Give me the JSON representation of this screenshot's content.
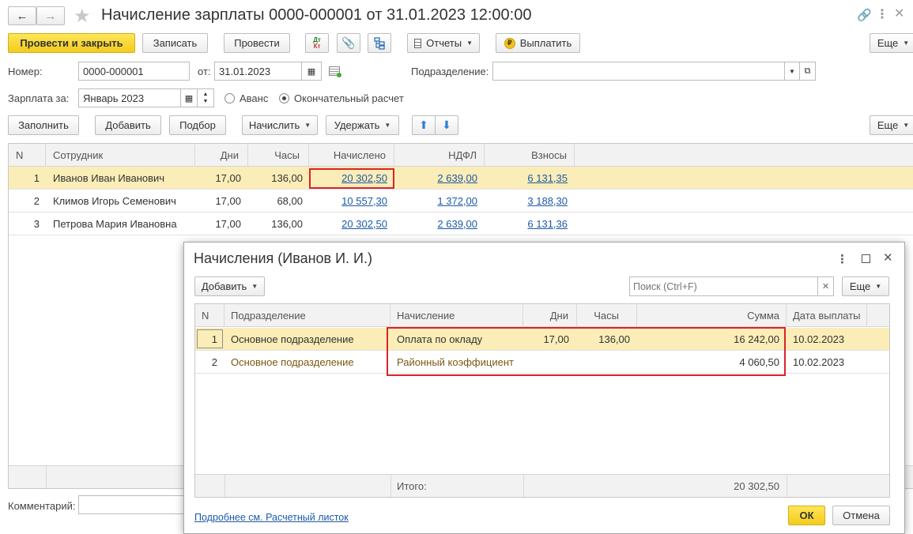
{
  "window": {
    "title": "Начисление зарплаты 0000-000001 от 31.01.2023 12:00:00",
    "nav_back": "←",
    "nav_forward": "→"
  },
  "toolbar": {
    "post_close": "Провести и закрыть",
    "save": "Записать",
    "post": "Провести",
    "dtkt": "Дт Кт",
    "reports": "Отчеты",
    "pay": "Выплатить",
    "more": "Еще"
  },
  "form": {
    "number_label": "Номер:",
    "number_value": "0000-000001",
    "date_label": "от:",
    "date_value": "31.01.2023",
    "dept_label": "Подразделение:",
    "dept_value": "",
    "salary_for_label": "Зарплата за:",
    "salary_for_value": "Январь 2023",
    "radio_advance": "Аванс",
    "radio_final": "Окончательный расчет"
  },
  "table_toolbar": {
    "fill": "Заполнить",
    "add": "Добавить",
    "select": "Подбор",
    "accrue": "Начислить",
    "withhold": "Удержать",
    "more": "Еще"
  },
  "main_table": {
    "headers": [
      "N",
      "Сотрудник",
      "Дни",
      "Часы",
      "Начислено",
      "НДФЛ",
      "Взносы"
    ],
    "rows": [
      {
        "n": "1",
        "employee": "Иванов Иван Иванович",
        "days": "17,00",
        "hours": "136,00",
        "accrued": "20 302,50",
        "ndfl": "2 639,00",
        "contrib": "6 131,35"
      },
      {
        "n": "2",
        "employee": "Климов Игорь Семенович",
        "days": "17,00",
        "hours": "68,00",
        "accrued": "10 557,30",
        "ndfl": "1 372,00",
        "contrib": "3 188,30"
      },
      {
        "n": "3",
        "employee": "Петрова Мария Ивановна",
        "days": "17,00",
        "hours": "136,00",
        "accrued": "20 302,50",
        "ndfl": "2 639,00",
        "contrib": "6 131,36"
      }
    ]
  },
  "comment": {
    "label": "Комментарий:",
    "value": ""
  },
  "dialog": {
    "title": "Начисления (Иванов И. И.)",
    "add": "Добавить",
    "search_placeholder": "Поиск (Ctrl+F)",
    "more": "Еще",
    "headers": [
      "N",
      "Подразделение",
      "Начисление",
      "Дни",
      "Часы",
      "Сумма",
      "Дата выплаты"
    ],
    "rows": [
      {
        "n": "1",
        "dept": "Основное подразделение",
        "accrual": "Оплата по окладу",
        "days": "17,00",
        "hours": "136,00",
        "sum": "16 242,00",
        "pay_date": "10.02.2023"
      },
      {
        "n": "2",
        "dept": "Основное подразделение",
        "accrual": "Районный коэффициент",
        "days": "",
        "hours": "",
        "sum": "4 060,50",
        "pay_date": "10.02.2023"
      }
    ],
    "footer_label": "Итого:",
    "footer_total": "20 302,50",
    "details_link": "Подробнее см. Расчетный листок",
    "ok": "ОК",
    "cancel": "Отмена"
  },
  "colors": {
    "primary_button": "#f3cb1e",
    "selected_row": "#fbedb7",
    "link": "#1d5aa8",
    "highlight_box": "#d9232d"
  }
}
